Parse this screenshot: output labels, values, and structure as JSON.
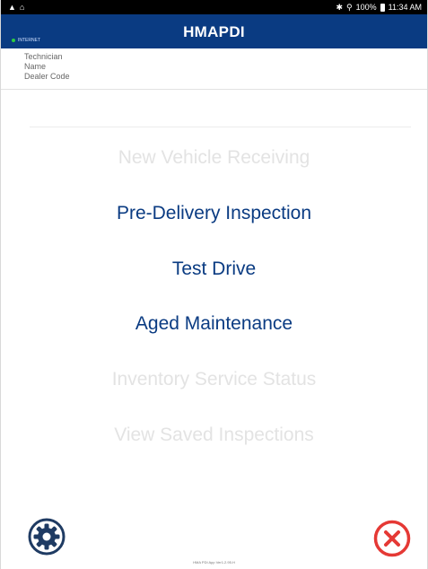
{
  "status_bar": {
    "battery": "100%",
    "time": "11:34 AM"
  },
  "app_bar": {
    "title": "HMAPDI",
    "network_label": "INTERNET"
  },
  "info": {
    "technician": "Technician",
    "name": "Name",
    "dealer_code": "Dealer Code"
  },
  "menu": {
    "new_vehicle_receiving": "New Vehicle Receiving",
    "pre_delivery_inspection": "Pre-Delivery Inspection",
    "test_drive": "Test Drive",
    "aged_maintenance": "Aged Maintenance",
    "inventory_service_status": "Inventory Service Status",
    "view_saved_inspections": "View Saved Inspections"
  },
  "footer": {
    "version": "HMA PDI App Ver1.2.95.H"
  },
  "colors": {
    "brand": "#0a3b82",
    "enabled_text": "#0a3b82",
    "disabled_text": "#e3e3e3",
    "close": "#e53935",
    "settings": "#1f3b63"
  },
  "icons": {
    "settings": "gear-icon",
    "close": "close-circle-icon"
  }
}
